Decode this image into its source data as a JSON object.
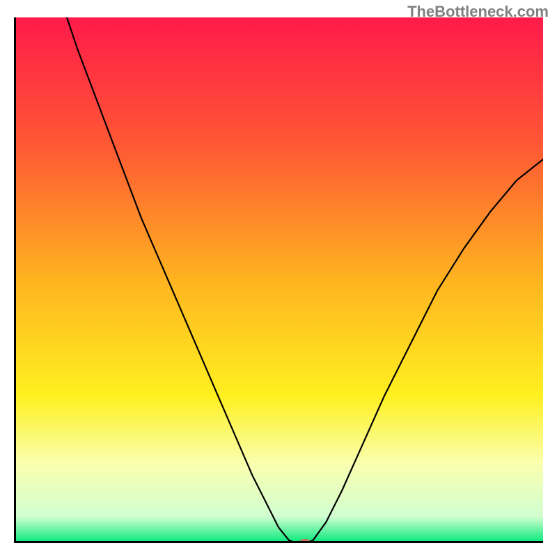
{
  "watermark": "TheBottleneck.com",
  "chart_data": {
    "type": "line",
    "title": "",
    "xlabel": "",
    "ylabel": "",
    "xlim": [
      0,
      100
    ],
    "ylim": [
      0,
      100
    ],
    "grid": false,
    "background_gradient": {
      "stops": [
        {
          "offset": 0.0,
          "color": "#ff1a4a"
        },
        {
          "offset": 0.25,
          "color": "#ff5a33"
        },
        {
          "offset": 0.5,
          "color": "#ffb420"
        },
        {
          "offset": 0.72,
          "color": "#fff020"
        },
        {
          "offset": 0.85,
          "color": "#faffb0"
        },
        {
          "offset": 0.95,
          "color": "#d0ffd0"
        },
        {
          "offset": 1.0,
          "color": "#00e878"
        }
      ]
    },
    "series": [
      {
        "name": "bottleneck-curve",
        "color": "#000000",
        "width": 2.2,
        "x": [
          10,
          12,
          15,
          18,
          21,
          24,
          27,
          30,
          33,
          36,
          39,
          42,
          45,
          48,
          50,
          52,
          53.5,
          55,
          56.5,
          59,
          62,
          66,
          70,
          75,
          80,
          85,
          90,
          95,
          100
        ],
        "y": [
          100,
          94,
          86,
          78,
          70,
          62,
          55,
          48,
          41,
          34,
          27,
          20,
          13,
          7,
          3,
          0.5,
          0,
          0,
          0.5,
          4,
          10,
          19,
          28,
          38,
          48,
          56,
          63,
          69,
          73
        ]
      }
    ],
    "marker": {
      "name": "optimal-point",
      "x": 55,
      "y": 0,
      "color": "#d46a5a",
      "rx": 9,
      "ry": 6
    },
    "axes": {
      "color": "#000000",
      "width": 6
    }
  }
}
